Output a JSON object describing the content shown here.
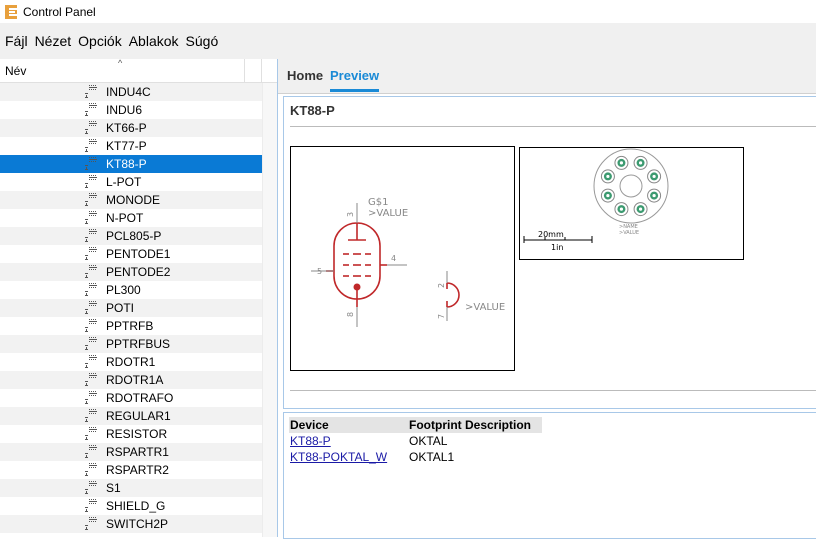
{
  "window": {
    "title": "Control Panel",
    "icon": "eagle-app-icon",
    "icon_color": "#e8a03c"
  },
  "menu": [
    "Fájl",
    "Nézet",
    "Opciók",
    "Ablakok",
    "Súgó"
  ],
  "list": {
    "header": "Név",
    "sort_indicator": "^",
    "items": [
      "INDU4C",
      "INDU6",
      "KT66-P",
      "KT77-P",
      "KT88-P",
      "L-POT",
      "MONODE",
      "N-POT",
      "PCL805-P",
      "PENTODE1",
      "PENTODE2",
      "PL300",
      "POTI",
      "PPTRFB",
      "PPTRFBUS",
      "RDOTR1",
      "RDOTR1A",
      "RDOTRAFO",
      "REGULAR1",
      "RESISTOR",
      "RSPARTR1",
      "RSPARTR2",
      "S1",
      "SHIELD_G",
      "SWITCH2P"
    ],
    "selected": "KT88-P",
    "selection_color": "#0a7ad5"
  },
  "tabs": {
    "home": "Home",
    "preview": "Preview",
    "active": "Preview",
    "accent": "#1a8ad6"
  },
  "preview": {
    "title": "KT88-P",
    "symbol": {
      "name_label": "G$1",
      "value_label": ">VALUE",
      "value_label2": ">VALUE",
      "pins": [
        "3",
        "4",
        "5",
        "8",
        "2",
        "7"
      ],
      "color": "#c0282a"
    },
    "footprint": {
      "name_label": ">NAME",
      "value_label": ">VALUE",
      "scale_metric": "20mm",
      "scale_imperial": "1in",
      "pad_color": "#3c9a70"
    }
  },
  "device_table": {
    "headers": [
      "Device",
      "Footprint Description"
    ],
    "rows": [
      {
        "device": "KT88-P",
        "footprint": "OKTAL"
      },
      {
        "device": "KT88-POKTAL_W",
        "footprint": "OKTAL1"
      }
    ]
  }
}
